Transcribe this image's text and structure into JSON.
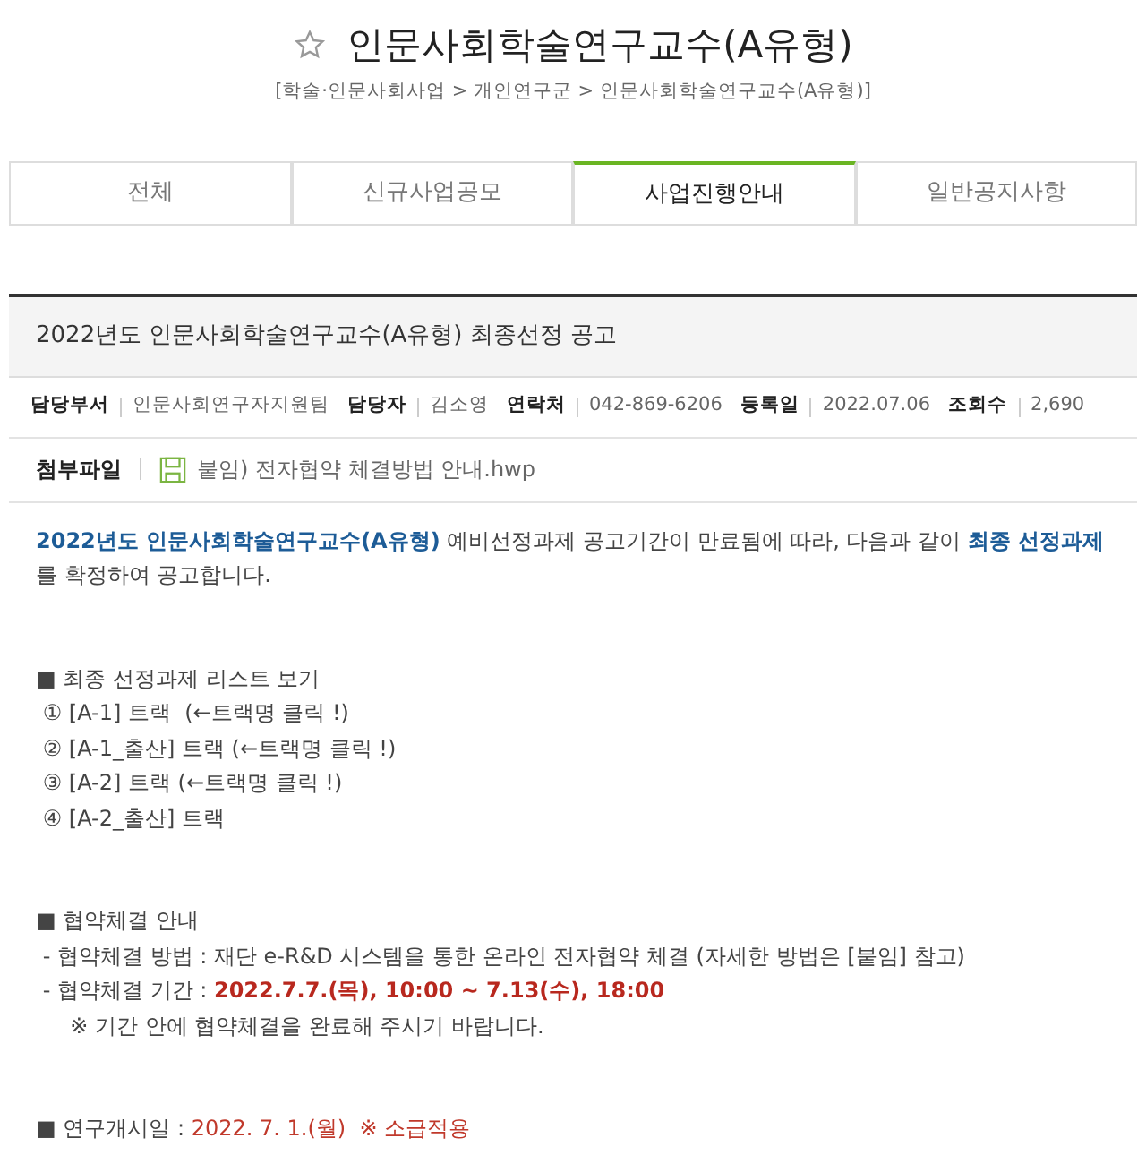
{
  "page_title": "인문사회학술연구교수(A유형)",
  "favorite": false,
  "breadcrumb": "[학술·인문사회사업 > 개인연구군 > 인문사회학술연구교수(A유형)]",
  "tabs": [
    {
      "label": "전체",
      "selected": false
    },
    {
      "label": "신규사업공모",
      "selected": false
    },
    {
      "label": "사업진행안내",
      "selected": true
    },
    {
      "label": "일반공지사항",
      "selected": false
    }
  ],
  "article": {
    "title": "2022년도 인문사회학술연구교수(A유형) 최종선정 공고",
    "meta": [
      {
        "label": "담당부서",
        "value": "인문사회연구자지원팀"
      },
      {
        "label": "담당자",
        "value": "김소영"
      },
      {
        "label": "연락처",
        "value": "042-869-6206"
      },
      {
        "label": "등록일",
        "value": "2022.07.06"
      },
      {
        "label": "조회수",
        "value": "2,690"
      }
    ],
    "attachment": {
      "label": "첨부파일",
      "file": "붙임) 전자협약 체결방법 안내.hwp"
    },
    "blocks": [
      {
        "lines": [
          [
            {
              "text": "2022년도 인문사회학술연구교수(A유형)",
              "kind": "highlight"
            },
            {
              "text": " 예비선정과제 공고기간이 만료됨에 따라, 다음과 같이 ",
              "kind": "normal"
            },
            {
              "text": "최종 선정과제",
              "kind": "highlight"
            },
            {
              "text": "를 확정하여 공고합니다.",
              "kind": "normal"
            }
          ]
        ]
      },
      {
        "lines": [
          [
            {
              "text": "■ 최종 선정과제 리스트 보기",
              "kind": "normal"
            }
          ],
          [
            {
              "text": " ① [A-1] 트랙  (←트랙명 클릭 !)",
              "kind": "normal"
            }
          ],
          [
            {
              "text": " ② [A-1_출산] 트랙 (←트랙명 클릭 !)",
              "kind": "normal"
            }
          ],
          [
            {
              "text": " ③ [A-2] 트랙 (←트랙명 클릭 !)",
              "kind": "normal"
            }
          ],
          [
            {
              "text": " ④ [A-2_출산] 트랙",
              "kind": "normal"
            }
          ]
        ]
      },
      {
        "lines": [
          [
            {
              "text": "■ 협약체결 안내",
              "kind": "normal"
            }
          ],
          [
            {
              "text": " - 협약체결 방법 : 재단 e-R&D 시스템을 통한 온라인 전자협약 체결 (자세한 방법은 [붙임] 참고)",
              "kind": "normal"
            }
          ],
          [
            {
              "text": " - 협약체결 기간 : ",
              "kind": "normal"
            },
            {
              "text": "2022.7.7.(목), 10:00 ~ 7.13(수), 18:00",
              "kind": "deadline"
            }
          ],
          [
            {
              "text": "     ※ 기간 안에 협약체결을 완료해 주시기 바랍니다.",
              "kind": "normal"
            }
          ]
        ]
      },
      {
        "lines": [
          [
            {
              "text": "■ 연구개시일 : ",
              "kind": "normal"
            },
            {
              "text": "2022. 7. 1.(월)  ※ 소급적용",
              "kind": "warning"
            }
          ]
        ]
      }
    ]
  }
}
